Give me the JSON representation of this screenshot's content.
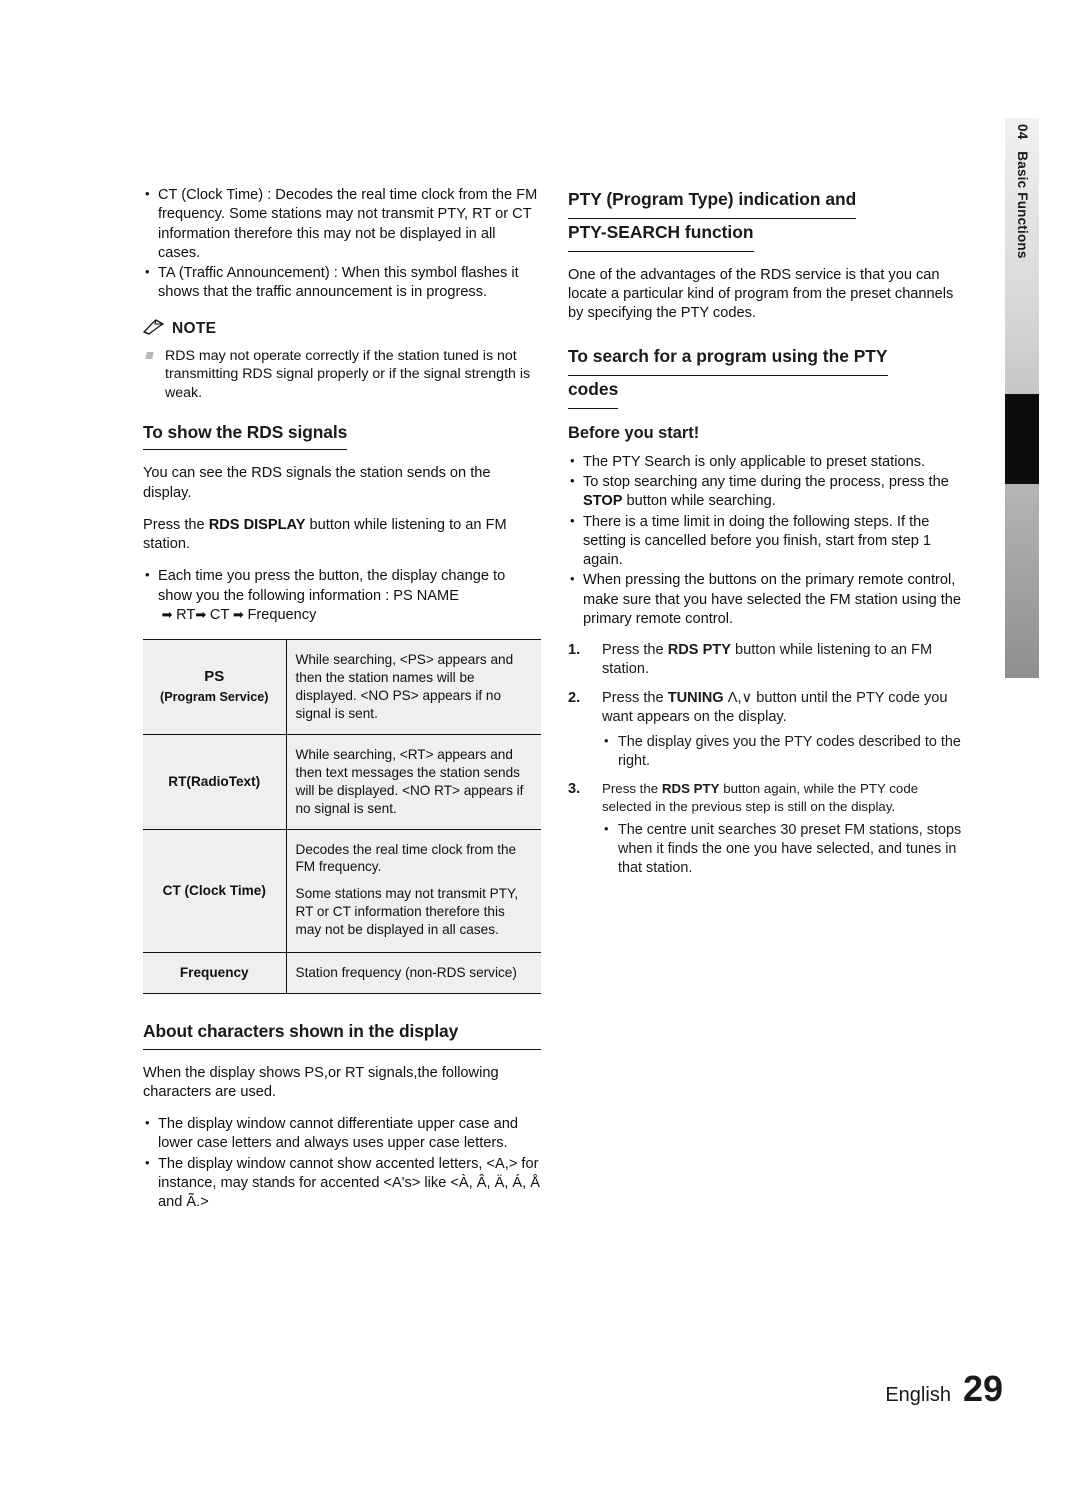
{
  "side_tab": {
    "chapter_number": "04",
    "chapter_label": "Basic Functions"
  },
  "left_column": {
    "intro_bullets": [
      "CT (Clock Time) : Decodes the real time clock from the FM frequency. Some stations may not transmit PTY, RT or CT information therefore this may not be displayed in all cases.",
      "TA (Traffic Announcement) :  When this symbol flashes it shows that the traffic announcement is in progress."
    ],
    "note": {
      "label": "NOTE",
      "items": [
        "RDS may not operate correctly if the station tuned is not transmitting RDS signal properly or if the signal strength is weak."
      ]
    },
    "heading_show_rds": "To show the RDS signals",
    "para_1": "You can see the RDS signals the station sends on the display.",
    "para_2_pre": "Press the ",
    "para_2_bold": "RDS DISPLAY",
    "para_2_post": " button while listening to an FM station.",
    "bullet_each_time": "Each time you press the button, the display change to show you the following information : PS NAME",
    "bullet_each_time_2": "RT",
    "bullet_each_time_3": "CT",
    "bullet_each_time_4": "Frequency",
    "table": {
      "rows": [
        {
          "label_main": "PS",
          "label_sub": "(Program Service)",
          "desc": "While searching, <PS> appears and then the station names will be displayed. <NO PS> appears if no signal is sent."
        },
        {
          "label_main": "RT(RadioText)",
          "label_sub": "",
          "desc": "While searching, <RT> appears and then text messages the station sends will be displayed. <NO RT> appears if no signal is sent."
        },
        {
          "label_main": "CT (Clock Time)",
          "label_sub": "",
          "desc_1": "Decodes the real time clock from the FM frequency.",
          "desc_2": "Some stations may not transmit PTY, RT or CT information therefore this may not be displayed in all cases."
        },
        {
          "label_main": "Frequency",
          "label_sub": "",
          "desc": "Station frequency (non-RDS service)"
        }
      ]
    },
    "heading_characters": "About characters shown in the display",
    "para_chars": "When the display shows PS,or RT signals,the following characters are used.",
    "char_bullets": [
      "The display window cannot differentiate upper case and lower case letters and always uses upper case letters.",
      "The display window cannot show accented letters, <A,> for instance, may stands for accented <A's> like <À, Â, Ä, Á, Å and Ã.>"
    ]
  },
  "right_column": {
    "heading_pty_line1": "PTY (Program Type) indication and",
    "heading_pty_line2": "PTY-SEARCH function",
    "para_pty": "One of the advantages of the RDS service is that you can locate a particular kind of program from the preset channels by specifying the PTY codes.",
    "heading_search_line1": "To search for a program using the PTY",
    "heading_search_line2": "codes",
    "heading_before": "Before you start!",
    "before_bullets": [
      "The PTY Search is only applicable to preset stations.",
      "To stop searching any time during the process, press the STOP button while searching.",
      "There is a time limit in doing the following steps. If the setting is cancelled before you finish, start from step 1 again.",
      "When pressing the buttons on the primary remote control, make sure that you have selected the FM station using the primary remote control."
    ],
    "before_bullet_2_pre": "To stop searching any time during the process, press the ",
    "before_bullet_2_bold": "STOP",
    "before_bullet_2_post": " button while searching.",
    "steps": [
      {
        "pre": "Press the ",
        "bold": "RDS PTY",
        "post": " button while listening to an FM station."
      },
      {
        "pre": "Press the ",
        "bold": "TUNING",
        "post": " button until the PTY code you want appears on the display.",
        "sub": [
          "The display gives you the PTY codes described to the right."
        ]
      },
      {
        "pre": "Press the ",
        "bold": "RDS PTY",
        "post": " button again, while the PTY code selected in the previous step is still on the display.",
        "sub": [
          "The centre unit searches 30 preset FM stations, stops when it finds the one you have selected, and tunes in that station."
        ]
      }
    ]
  },
  "footer": {
    "language": "English",
    "page_number": "29"
  }
}
